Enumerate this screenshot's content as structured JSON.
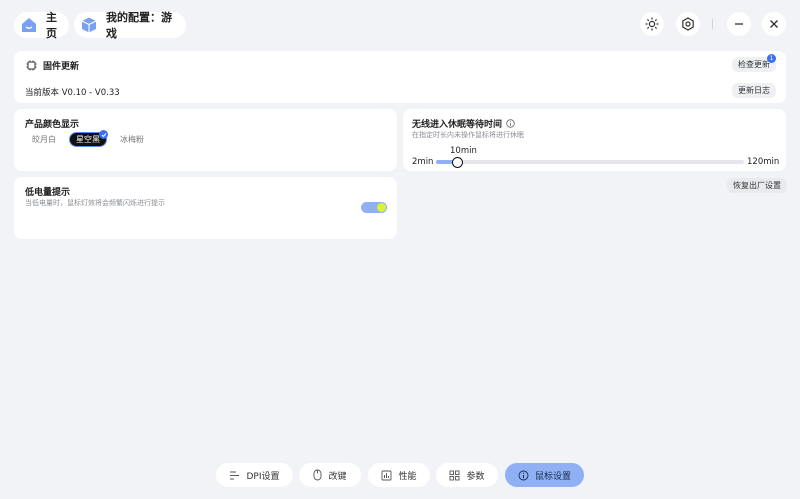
{
  "header": {
    "home_label": "主页",
    "config_label": "我的配置：游戏"
  },
  "firmware": {
    "title": "固件更新",
    "check_label": "检查更新",
    "badge": "1",
    "version_text": "当前版本 V0.10 - V0.33",
    "changelog_label": "更新日志"
  },
  "color_display": {
    "title": "产品颜色显示",
    "options": [
      "皎月白",
      "星空黑",
      "冰梅粉"
    ],
    "selected": "星空黑"
  },
  "sleep": {
    "title": "无线进入休眠等待时间",
    "desc": "在指定时长内未操作鼠标将进行休眠",
    "current": "10min",
    "min_label": "2min",
    "max_label": "120min",
    "fraction": 0.07
  },
  "low_battery": {
    "title": "低电量提示",
    "desc": "当低电量时，鼠标灯效将会频繁闪烁进行提示",
    "enabled": true
  },
  "reset_label": "恢复出厂设置",
  "bottom_nav": [
    {
      "label": "DPI设置",
      "icon": "dpi-icon"
    },
    {
      "label": "改键",
      "icon": "mouse-icon"
    },
    {
      "label": "性能",
      "icon": "chart-icon"
    },
    {
      "label": "参数",
      "icon": "grid-icon"
    },
    {
      "label": "鼠标设置",
      "icon": "info-icon"
    }
  ],
  "colors": {
    "accent": "#8fb0f4",
    "toggle_knob": "#d8f23a"
  }
}
